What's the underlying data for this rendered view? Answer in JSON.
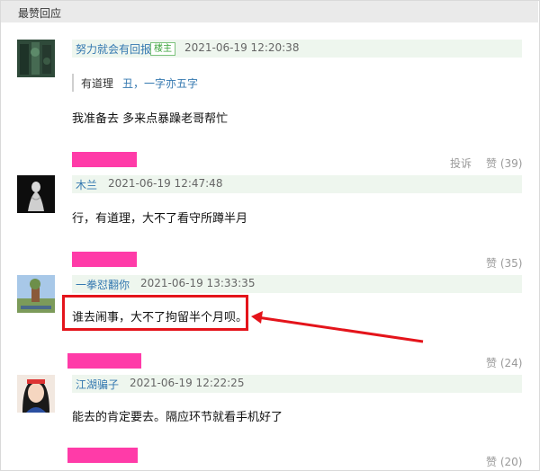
{
  "section": {
    "title": "最赞回应"
  },
  "comments": [
    {
      "author": "努力就会有回报",
      "badge": "楼主",
      "time": "2021-06-19 12:20:38",
      "quote": {
        "text": "有道理",
        "author": "丑，一字亦五字"
      },
      "content": "我准备去 多来点暴躁老哥帮忙",
      "report": "投诉",
      "likes": "赞 (39)"
    },
    {
      "author": "木兰",
      "time": "2021-06-19 12:47:48",
      "content": "行，有道理，大不了看守所蹲半月",
      "likes": "赞 (35)"
    },
    {
      "author": "一拳怼翻你",
      "time": "2021-06-19 13:33:35",
      "content": "谁去闹事，大不了拘留半个月呗。",
      "likes": "赞 (24)"
    },
    {
      "author": "江湖骗子",
      "time": "2021-06-19 12:22:25",
      "content": "能去的肯定要去。隔应环节就看手机好了",
      "likes": "赞 (20)"
    }
  ],
  "colors": {
    "annotation": "#e4141b",
    "redaction": "#ff3ba8",
    "link": "#3478b0",
    "meta_bg": "#eef6ee"
  }
}
